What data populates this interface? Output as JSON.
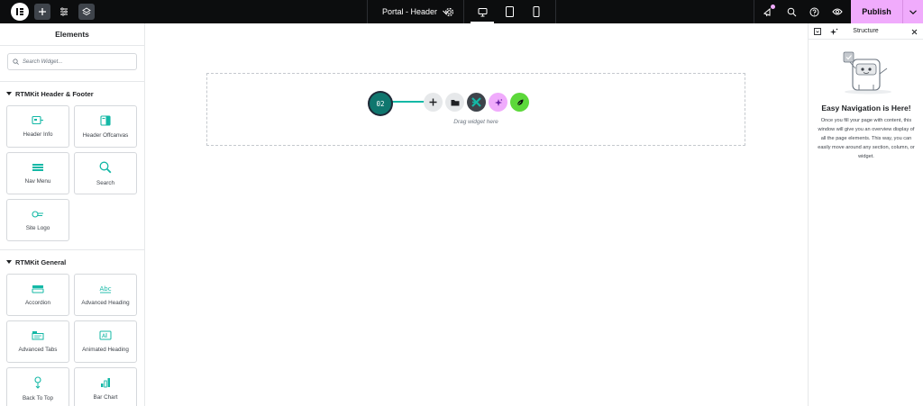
{
  "topbar": {
    "logo_icon": "elementor-logo",
    "add_icon": "plus-icon",
    "settings_icon": "sliders-icon",
    "structure_icon": "layers-icon",
    "document_title": "Portal - Header",
    "document_chevron": "chevron-down-icon",
    "document_settings_icon": "gear-icon",
    "devices": [
      "desktop-icon",
      "tablet-icon",
      "mobile-icon"
    ],
    "tools": [
      "whats-new-icon",
      "finder-icon",
      "help-icon",
      "preview-icon"
    ],
    "publish_label": "Publish",
    "accent_color": "#f0abfc"
  },
  "left_panel": {
    "title": "Elements",
    "search_placeholder": "Search Widget...",
    "categories": [
      {
        "title": "RTMKit Header & Footer",
        "widgets": [
          {
            "label": "Header Info",
            "icon": "header-info-icon"
          },
          {
            "label": "Header Offcanvas",
            "icon": "offcanvas-icon"
          },
          {
            "label": "Nav Menu",
            "icon": "nav-menu-icon"
          },
          {
            "label": "Search",
            "icon": "search-icon"
          },
          {
            "label": "Site Logo",
            "icon": "site-logo-icon"
          }
        ]
      },
      {
        "title": "RTMKit General",
        "widgets": [
          {
            "label": "Accordion",
            "icon": "accordion-icon"
          },
          {
            "label": "Advanced Heading",
            "icon": "advanced-heading-icon"
          },
          {
            "label": "Advanced Tabs",
            "icon": "advanced-tabs-icon"
          },
          {
            "label": "Animated Heading",
            "icon": "animated-heading-icon"
          },
          {
            "label": "Back To Top",
            "icon": "back-to-top-icon"
          },
          {
            "label": "Bar Chart",
            "icon": "bar-chart-icon"
          }
        ]
      }
    ],
    "widget_icon_color": "#14b8a6"
  },
  "canvas": {
    "badge_text": "02",
    "drop_hint": "Drag widget here",
    "buttons": [
      "add-section-icon",
      "template-library-icon",
      "rtmkit-icon",
      "ai-icon",
      "leaf-icon"
    ]
  },
  "structure_panel": {
    "title": "Structure",
    "heading": "Easy Navigation is Here!",
    "description": "Once you fill your page with content, this window will give you an overview display of all the page elements. This way, you can easily move around any section, column, or widget."
  }
}
